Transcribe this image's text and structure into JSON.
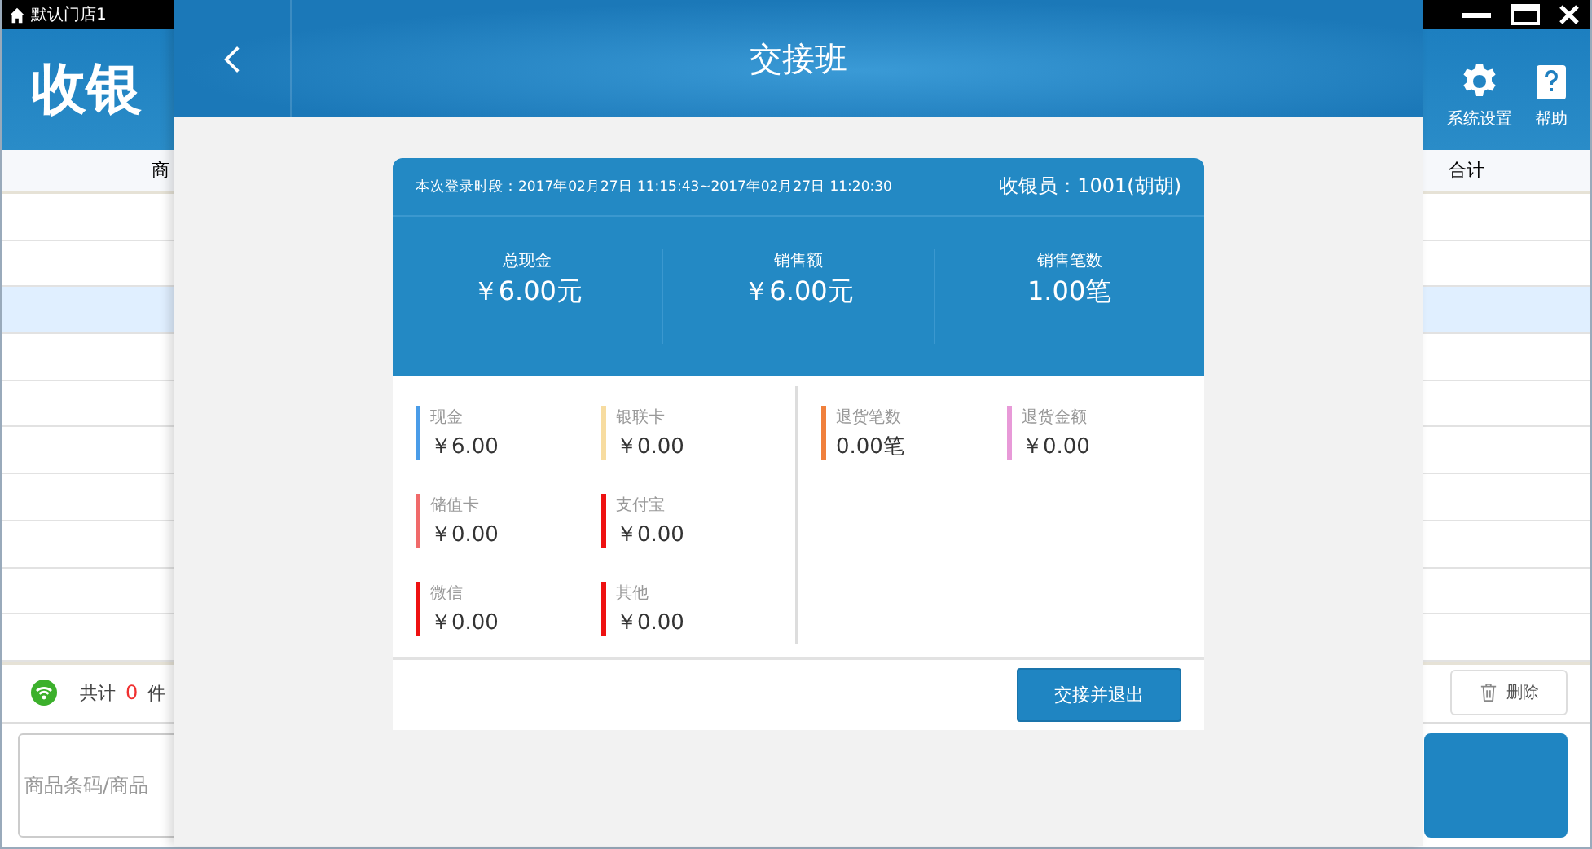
{
  "window": {
    "title": "默认门店1"
  },
  "app": {
    "logo": "收银",
    "toolbar": [
      {
        "label": "系统设置"
      },
      {
        "label": "帮助"
      }
    ]
  },
  "table": {
    "columns": [
      "商",
      "合计"
    ],
    "rows": [
      {
        "selected": false
      },
      {
        "selected": false
      },
      {
        "selected": true
      },
      {
        "selected": false
      },
      {
        "selected": false
      },
      {
        "selected": false
      },
      {
        "selected": false
      },
      {
        "selected": false
      },
      {
        "selected": false
      },
      {
        "selected": false
      }
    ]
  },
  "status": {
    "total_label": "共计",
    "count": "0",
    "unit": "件",
    "delete": "删除"
  },
  "barcode": {
    "placeholder": "商品条码/商品"
  },
  "dialog": {
    "title": "交接班",
    "period": "本次登录时段：2017年02月27日 11:15:43~2017年02月27日 11:20:30",
    "cashier": "收银员：1001(胡胡)",
    "stats": [
      {
        "label": "总现金",
        "value": "￥6.00元"
      },
      {
        "label": "销售额",
        "value": "￥6.00元"
      },
      {
        "label": "销售笔数",
        "value": "1.00笔"
      }
    ],
    "payments": [
      {
        "label": "现金",
        "value": "￥6.00",
        "color": "#4a9ce8"
      },
      {
        "label": "银联卡",
        "value": "￥0.00",
        "color": "#f7dca0"
      },
      {
        "label": "储值卡",
        "value": "￥0.00",
        "color": "#f06a6a"
      },
      {
        "label": "支付宝",
        "value": "￥0.00",
        "color": "#ee1111"
      },
      {
        "label": "微信",
        "value": "￥0.00",
        "color": "#ee1111"
      },
      {
        "label": "其他",
        "value": "￥0.00",
        "color": "#ee1111"
      }
    ],
    "returns": [
      {
        "label": "退货笔数",
        "value": "0.00笔",
        "color": "#f0803c"
      },
      {
        "label": "退货金额",
        "value": "￥0.00",
        "color": "#e89ad8"
      }
    ],
    "action": "交接并退出"
  }
}
